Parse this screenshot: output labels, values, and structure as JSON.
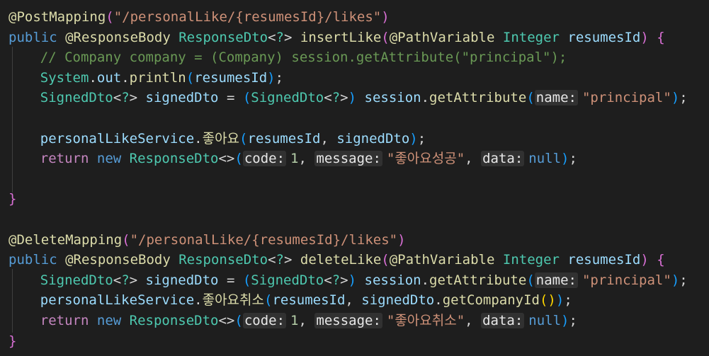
{
  "theme": {
    "background": "#1e1e1e",
    "annotation": "#dcdcaa",
    "string": "#ce9178",
    "keyword": "#569cd6",
    "type": "#4ec9b0",
    "variable": "#9cdcfe",
    "comment": "#6a9955",
    "number": "#b5cea8",
    "hint_bg": "#313131"
  },
  "lines": [
    {
      "tokens": [
        {
          "c": "annotation",
          "t": "@PostMapping"
        },
        {
          "c": "paren1",
          "t": "("
        },
        {
          "c": "string",
          "t": "\"/personalLike/{resumesId}/likes\""
        },
        {
          "c": "paren1",
          "t": ")"
        }
      ]
    },
    {
      "tokens": [
        {
          "c": "keyword",
          "t": "public "
        },
        {
          "c": "annotation",
          "t": "@ResponseBody "
        },
        {
          "c": "type",
          "t": "ResponseDto"
        },
        {
          "c": "plain",
          "t": "<"
        },
        {
          "c": "type",
          "t": "?"
        },
        {
          "c": "plain",
          "t": "> "
        },
        {
          "c": "method",
          "t": "insertLike"
        },
        {
          "c": "paren1",
          "t": "("
        },
        {
          "c": "annotation",
          "t": "@PathVariable "
        },
        {
          "c": "type",
          "t": "Integer "
        },
        {
          "c": "variable",
          "t": "resumesId"
        },
        {
          "c": "paren1",
          "t": ")"
        },
        {
          "c": "plain",
          "t": " "
        },
        {
          "c": "paren1",
          "t": "{"
        }
      ]
    },
    {
      "indent": 4,
      "tokens": [
        {
          "c": "comment",
          "t": "// Company company = (Company) session.getAttribute(\"principal\");"
        }
      ]
    },
    {
      "indent": 4,
      "tokens": [
        {
          "c": "type",
          "t": "System"
        },
        {
          "c": "plain",
          "t": "."
        },
        {
          "c": "variable",
          "t": "out"
        },
        {
          "c": "plain",
          "t": "."
        },
        {
          "c": "method",
          "t": "println"
        },
        {
          "c": "paren2",
          "t": "("
        },
        {
          "c": "variable",
          "t": "resumesId"
        },
        {
          "c": "paren2",
          "t": ")"
        },
        {
          "c": "plain",
          "t": ";"
        }
      ]
    },
    {
      "indent": 4,
      "tokens": [
        {
          "c": "type",
          "t": "SignedDto"
        },
        {
          "c": "plain",
          "t": "<"
        },
        {
          "c": "type",
          "t": "?"
        },
        {
          "c": "plain",
          "t": "> "
        },
        {
          "c": "variable",
          "t": "signedDto"
        },
        {
          "c": "plain",
          "t": " = "
        },
        {
          "c": "paren2",
          "t": "("
        },
        {
          "c": "type",
          "t": "SignedDto"
        },
        {
          "c": "plain",
          "t": "<"
        },
        {
          "c": "type",
          "t": "?"
        },
        {
          "c": "plain",
          "t": ">"
        },
        {
          "c": "paren2",
          "t": ")"
        },
        {
          "c": "plain",
          "t": " "
        },
        {
          "c": "variable",
          "t": "session"
        },
        {
          "c": "plain",
          "t": "."
        },
        {
          "c": "method",
          "t": "getAttribute"
        },
        {
          "c": "paren2",
          "t": "("
        },
        {
          "c": "hint",
          "t": "name:"
        },
        {
          "c": "string",
          "t": "\"principal\""
        },
        {
          "c": "paren2",
          "t": ")"
        },
        {
          "c": "plain",
          "t": ";"
        }
      ]
    },
    {
      "indent": 0,
      "tokens": []
    },
    {
      "indent": 4,
      "tokens": [
        {
          "c": "variable",
          "t": "personalLikeService"
        },
        {
          "c": "plain",
          "t": "."
        },
        {
          "c": "method",
          "t": "좋아요"
        },
        {
          "c": "paren2",
          "t": "("
        },
        {
          "c": "variable",
          "t": "resumesId"
        },
        {
          "c": "plain",
          "t": ", "
        },
        {
          "c": "variable",
          "t": "signedDto"
        },
        {
          "c": "paren2",
          "t": ")"
        },
        {
          "c": "plain",
          "t": ";"
        }
      ]
    },
    {
      "indent": 4,
      "tokens": [
        {
          "c": "ctrl",
          "t": "return "
        },
        {
          "c": "keyword",
          "t": "new "
        },
        {
          "c": "type",
          "t": "ResponseDto"
        },
        {
          "c": "plain",
          "t": "<>"
        },
        {
          "c": "paren2",
          "t": "("
        },
        {
          "c": "hint",
          "t": "code:"
        },
        {
          "c": "number",
          "t": "1"
        },
        {
          "c": "plain",
          "t": ", "
        },
        {
          "c": "hint",
          "t": "message:"
        },
        {
          "c": "string",
          "t": "\"좋아요성공\""
        },
        {
          "c": "plain",
          "t": ", "
        },
        {
          "c": "hint",
          "t": "data:"
        },
        {
          "c": "keyword",
          "t": "null"
        },
        {
          "c": "paren2",
          "t": ")"
        },
        {
          "c": "plain",
          "t": ";"
        }
      ]
    },
    {
      "indent": 0,
      "tokens": []
    },
    {
      "indent": 0,
      "tokens": [
        {
          "c": "paren1",
          "t": "}"
        }
      ]
    },
    {
      "indent": 0,
      "tokens": []
    },
    {
      "tokens": [
        {
          "c": "annotation",
          "t": "@DeleteMapping"
        },
        {
          "c": "paren1",
          "t": "("
        },
        {
          "c": "string",
          "t": "\"/personalLike/{resumesId}/likes\""
        },
        {
          "c": "paren1",
          "t": ")"
        }
      ]
    },
    {
      "tokens": [
        {
          "c": "keyword",
          "t": "public "
        },
        {
          "c": "annotation",
          "t": "@ResponseBody "
        },
        {
          "c": "type",
          "t": "ResponseDto"
        },
        {
          "c": "plain",
          "t": "<"
        },
        {
          "c": "type",
          "t": "?"
        },
        {
          "c": "plain",
          "t": "> "
        },
        {
          "c": "method",
          "t": "deleteLike"
        },
        {
          "c": "paren1",
          "t": "("
        },
        {
          "c": "annotation",
          "t": "@PathVariable "
        },
        {
          "c": "type",
          "t": "Integer "
        },
        {
          "c": "variable",
          "t": "resumesId"
        },
        {
          "c": "paren1",
          "t": ")"
        },
        {
          "c": "plain",
          "t": " "
        },
        {
          "c": "paren1",
          "t": "{"
        }
      ]
    },
    {
      "indent": 4,
      "tokens": [
        {
          "c": "type",
          "t": "SignedDto"
        },
        {
          "c": "plain",
          "t": "<"
        },
        {
          "c": "type",
          "t": "?"
        },
        {
          "c": "plain",
          "t": "> "
        },
        {
          "c": "variable",
          "t": "signedDto"
        },
        {
          "c": "plain",
          "t": " = "
        },
        {
          "c": "paren2",
          "t": "("
        },
        {
          "c": "type",
          "t": "SignedDto"
        },
        {
          "c": "plain",
          "t": "<"
        },
        {
          "c": "type",
          "t": "?"
        },
        {
          "c": "plain",
          "t": ">"
        },
        {
          "c": "paren2",
          "t": ")"
        },
        {
          "c": "plain",
          "t": " "
        },
        {
          "c": "variable",
          "t": "session"
        },
        {
          "c": "plain",
          "t": "."
        },
        {
          "c": "method",
          "t": "getAttribute"
        },
        {
          "c": "paren2",
          "t": "("
        },
        {
          "c": "hint",
          "t": "name:"
        },
        {
          "c": "string",
          "t": "\"principal\""
        },
        {
          "c": "paren2",
          "t": ")"
        },
        {
          "c": "plain",
          "t": ";"
        }
      ]
    },
    {
      "indent": 4,
      "tokens": [
        {
          "c": "variable",
          "t": "personalLikeService"
        },
        {
          "c": "plain",
          "t": "."
        },
        {
          "c": "method",
          "t": "좋아요취소"
        },
        {
          "c": "paren2",
          "t": "("
        },
        {
          "c": "variable",
          "t": "resumesId"
        },
        {
          "c": "plain",
          "t": ", "
        },
        {
          "c": "variable",
          "t": "signedDto"
        },
        {
          "c": "plain",
          "t": "."
        },
        {
          "c": "method",
          "t": "getCompanyId"
        },
        {
          "c": "paren3",
          "t": "()"
        },
        {
          "c": "paren2",
          "t": ")"
        },
        {
          "c": "plain",
          "t": ";"
        }
      ]
    },
    {
      "indent": 4,
      "tokens": [
        {
          "c": "ctrl",
          "t": "return "
        },
        {
          "c": "keyword",
          "t": "new "
        },
        {
          "c": "type",
          "t": "ResponseDto"
        },
        {
          "c": "plain",
          "t": "<>"
        },
        {
          "c": "paren2",
          "t": "("
        },
        {
          "c": "hint",
          "t": "code:"
        },
        {
          "c": "number",
          "t": "1"
        },
        {
          "c": "plain",
          "t": ", "
        },
        {
          "c": "hint",
          "t": "message:"
        },
        {
          "c": "string",
          "t": "\"좋아요취소\""
        },
        {
          "c": "plain",
          "t": ", "
        },
        {
          "c": "hint",
          "t": "data:"
        },
        {
          "c": "keyword",
          "t": "null"
        },
        {
          "c": "paren2",
          "t": ")"
        },
        {
          "c": "plain",
          "t": ";"
        }
      ]
    },
    {
      "indent": 0,
      "tokens": [
        {
          "c": "paren1",
          "t": "}"
        }
      ]
    }
  ]
}
